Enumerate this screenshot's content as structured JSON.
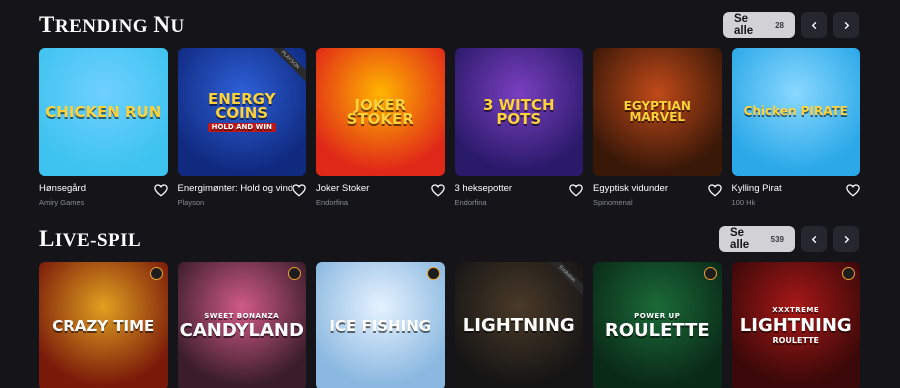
{
  "trending": {
    "title": "Trending nu",
    "see_all_label": "Se alle",
    "see_all_count": "28",
    "games": [
      {
        "name": "Hønsegård",
        "provider": "Amiry Games",
        "art_text": "CHICKEN RUN",
        "colors": [
          "#3ec3f0",
          "#6fd0ff"
        ]
      },
      {
        "name": "Energimønter: Hold og vind",
        "provider": "Playson",
        "art_text": "ENERGY COINS",
        "art_sub": "HOLD AND WIN",
        "corner": "PLAYSON",
        "colors": [
          "#102a80",
          "#2d60d8"
        ]
      },
      {
        "name": "Joker Stoker",
        "provider": "Endorfina",
        "art_text": "JOKER STOKER",
        "colors": [
          "#e02818",
          "#ffb400"
        ]
      },
      {
        "name": "3 heksepotter",
        "provider": "Endorfina",
        "art_text": "3 WITCH POTS",
        "colors": [
          "#2a1a6a",
          "#7a3fc0"
        ]
      },
      {
        "name": "Egyptisk vidunder",
        "provider": "Spinomenal",
        "art_text": "EGYPTIAN MARVEL",
        "colors": [
          "#3a1808",
          "#c04a18"
        ]
      },
      {
        "name": "Kylling Pirat",
        "provider": "100 Hk",
        "art_text": "Chicken PIRATE",
        "colors": [
          "#2aa8e8",
          "#8ad8ff"
        ]
      }
    ]
  },
  "live": {
    "title": "Live-spil",
    "see_all_label": "Se alle",
    "see_all_count": "539",
    "games": [
      {
        "art_text": "CRAZY TIME",
        "colors": [
          "#7a1a0a",
          "#e0a020"
        ]
      },
      {
        "art_text": "CANDYLAND",
        "art_sub": "SWEET BONANZA",
        "colors": [
          "#3a1d2a",
          "#d05a88"
        ]
      },
      {
        "art_text": "ICE FISHING",
        "colors": [
          "#8ab8e0",
          "#e6f2ff"
        ]
      },
      {
        "art_text": "LIGHTNING",
        "corner": "Evolution",
        "colors": [
          "#151515",
          "#4a3a28"
        ]
      },
      {
        "art_text": "ROULETTE",
        "art_sub": "POWER UP",
        "colors": [
          "#0a2a18",
          "#1a6a38"
        ]
      },
      {
        "art_text": "LIGHTNING",
        "art_sub": "XXXTREME",
        "art_sub2": "ROULETTE",
        "colors": [
          "#3a0808",
          "#a81818"
        ]
      }
    ]
  }
}
